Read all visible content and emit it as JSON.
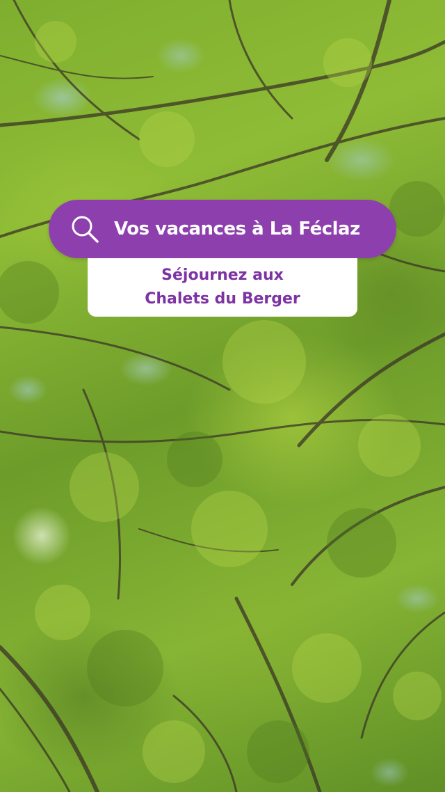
{
  "background": {
    "scene": "tree canopy photo",
    "colors": {
      "foliage": "#86b434",
      "sky": "#aad2eb",
      "branch": "#3a3526"
    }
  },
  "search_bar": {
    "icon": "search-icon",
    "text": "Vos vacances à La Féclaz",
    "color": "#8e3fae"
  },
  "subtitle": {
    "line1": "Séjournez aux",
    "line2": "Chalets du Berger",
    "color": "#7d33a3"
  }
}
